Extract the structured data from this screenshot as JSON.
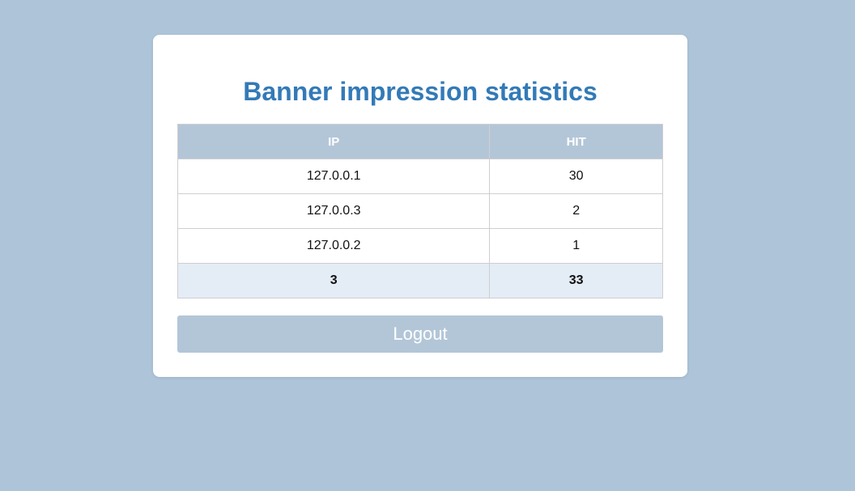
{
  "page": {
    "title": "Banner impression statistics"
  },
  "table": {
    "headers": {
      "ip": "IP",
      "hit": "HIT"
    },
    "rows": [
      {
        "ip": "127.0.0.1",
        "hit": "30"
      },
      {
        "ip": "127.0.0.3",
        "hit": "2"
      },
      {
        "ip": "127.0.0.2",
        "hit": "1"
      }
    ],
    "totals": {
      "ip": "3",
      "hit": "33"
    }
  },
  "actions": {
    "logout_label": "Logout"
  },
  "colors": {
    "background": "#aec4d8",
    "title": "#337ab7",
    "header_bg": "#b3c6d8",
    "total_row_bg": "#e4ecf6",
    "button_bg": "#b3c6d8"
  }
}
